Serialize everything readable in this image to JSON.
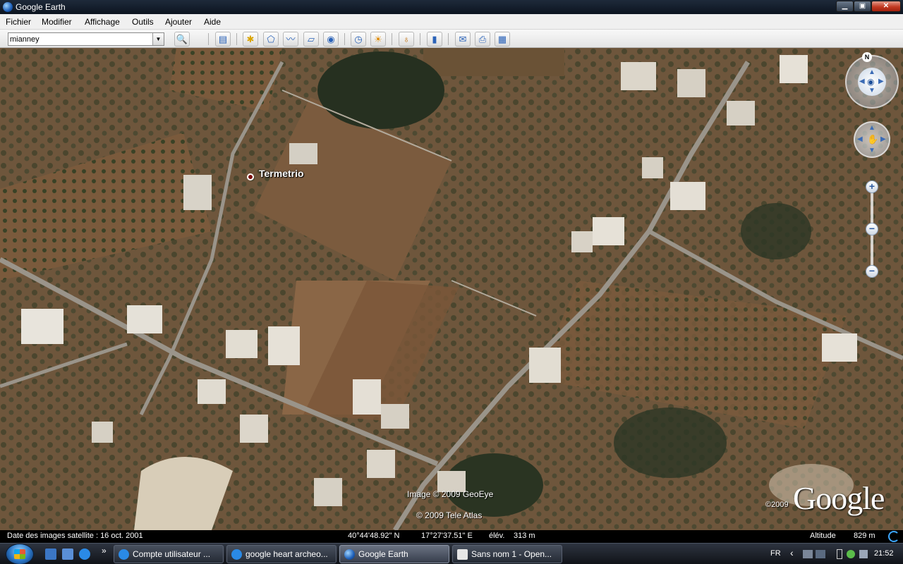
{
  "window": {
    "title": "Google Earth",
    "min_glyph": "▁",
    "max_glyph": "▣",
    "close_glyph": "✕"
  },
  "menu": [
    "Fichier",
    "Modifier",
    "Affichage",
    "Outils",
    "Ajouter",
    "Aide"
  ],
  "search": {
    "value": "mianney",
    "dropdown_glyph": "▼"
  },
  "toolbar": {
    "buttons": [
      {
        "name": "search-button",
        "icon": "magnifier-icon",
        "glyph": "🔍"
      },
      {
        "name": "sidebar-toggle-button",
        "icon": "sidebar-icon",
        "glyph": "▤"
      },
      {
        "name": "add-placemark-button",
        "icon": "pushpin-icon",
        "glyph": "✱"
      },
      {
        "name": "add-polygon-button",
        "icon": "polygon-icon",
        "glyph": "⬠"
      },
      {
        "name": "add-path-button",
        "icon": "path-icon",
        "glyph": "〰"
      },
      {
        "name": "add-image-overlay-button",
        "icon": "overlay-icon",
        "glyph": "▱"
      },
      {
        "name": "record-tour-button",
        "icon": "camera-icon",
        "glyph": "◉"
      },
      {
        "name": "historical-imagery-button",
        "icon": "clock-icon",
        "glyph": "◷"
      },
      {
        "name": "sunlight-button",
        "icon": "sun-icon",
        "glyph": "☀"
      },
      {
        "name": "planets-button",
        "icon": "planet-icon",
        "glyph": "♁"
      },
      {
        "name": "ruler-button",
        "icon": "ruler-icon",
        "glyph": "▮"
      },
      {
        "name": "email-button",
        "icon": "envelope-icon",
        "glyph": "✉"
      },
      {
        "name": "print-button",
        "icon": "printer-icon",
        "glyph": "⎙"
      },
      {
        "name": "view-in-maps-button",
        "icon": "map-icon",
        "glyph": "▦"
      }
    ]
  },
  "map": {
    "placemark_label": "Termetrio",
    "credit_imagery": "Image © 2009 GeoEye",
    "credit_tele_atlas": "© 2009 Tele Atlas",
    "google_year": "©2009",
    "google_logo": "Google",
    "north_label": "N",
    "zoom_in": "+",
    "zoom_mid": "−",
    "zoom_out": "−"
  },
  "status": {
    "imagery_date": "Date des images satellite : 16 oct. 2001",
    "latitude": "40°44'48.92\" N",
    "longitude": "17°27'37.51\" E",
    "elevation_label": "élév.",
    "elevation_value": "313 m",
    "altitude_label": "Altitude",
    "altitude_value": "829 m"
  },
  "taskbar": {
    "tasks": [
      {
        "label": "Compte utilisateur ...",
        "icon": "ie-icon",
        "active": false
      },
      {
        "label": "google heart archeo...",
        "icon": "ie-icon",
        "active": false
      },
      {
        "label": "Google Earth",
        "icon": "earth-icon",
        "active": true
      },
      {
        "label": "Sans nom 1 - Open...",
        "icon": "document-icon",
        "active": false
      }
    ],
    "overflow_glyph": "»",
    "language": "FR",
    "tray_chevron": "‹",
    "clock": "21:52"
  },
  "colors": {
    "field_brown": "#7a5a3a",
    "vegetation": "#2f3a22",
    "road": "#8f8a82",
    "building": "#e6e2da"
  }
}
